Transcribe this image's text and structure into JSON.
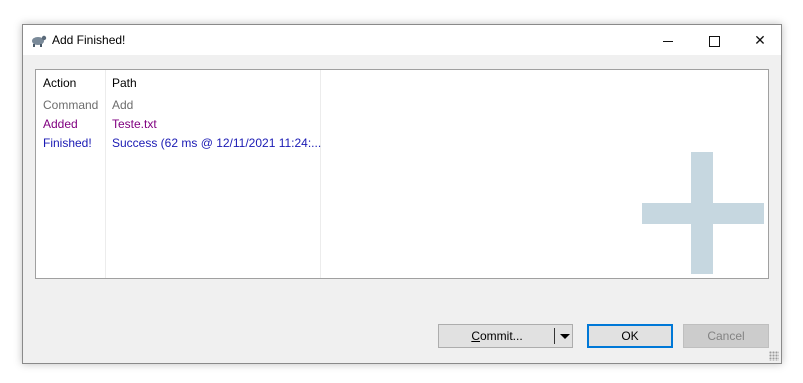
{
  "window": {
    "title": "Add Finished!",
    "controls": {
      "minimize": "minimize",
      "maximize": "maximize",
      "close": "✕"
    }
  },
  "list": {
    "columns": [
      "Action",
      "Path"
    ],
    "rows": [
      {
        "action": "Command",
        "path": "Add",
        "color": "#6d6d6d"
      },
      {
        "action": "Added",
        "path": "Teste.txt",
        "color": "#800080"
      },
      {
        "action": "Finished!",
        "path": "Success (62 ms @ 12/11/2021 11:24:...",
        "color": "#1a1ab4"
      }
    ],
    "watermark_icon": "plus-icon"
  },
  "buttons": {
    "commit_label": "Commit...",
    "ok_label": "OK",
    "cancel_label": "Cancel"
  },
  "colors": {
    "accent": "#0078d7",
    "watermark": "#c6d7e0"
  }
}
